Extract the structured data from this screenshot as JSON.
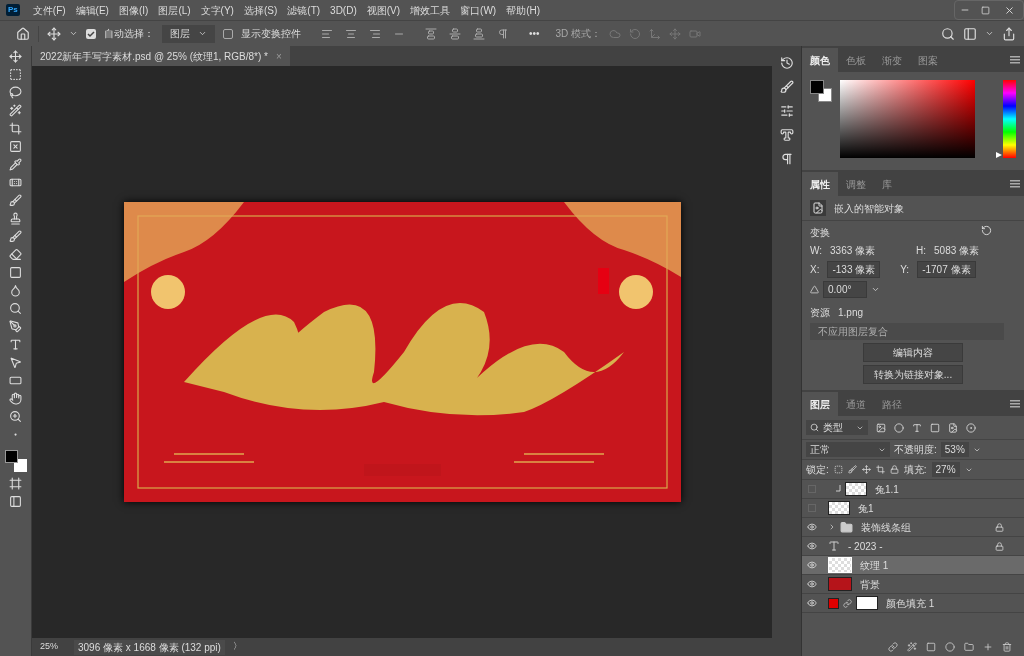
{
  "app_logo": "Ps",
  "menu": [
    "文件(F)",
    "编辑(E)",
    "图像(I)",
    "图层(L)",
    "文字(Y)",
    "选择(S)",
    "滤镜(T)",
    "3D(D)",
    "视图(V)",
    "增效工具",
    "窗口(W)",
    "帮助(H)"
  ],
  "options_bar": {
    "auto_select": {
      "label": "自动选择：",
      "checked": true
    },
    "target": "图层",
    "show_transform": {
      "label": "显示变换控件",
      "checked": false
    },
    "more": "•••",
    "mode_3d": "3D 模式："
  },
  "document_tab": {
    "title": "2022新年手写字素材.psd @ 25% (纹理1, RGB/8*) *",
    "close": "×"
  },
  "color_panel": {
    "tabs": [
      {
        "label": "颜色",
        "selected": true
      },
      {
        "label": "色板",
        "selected": false
      },
      {
        "label": "渐变",
        "selected": false
      },
      {
        "label": "图案",
        "selected": false
      }
    ],
    "hue_slider": {
      "level": 0
    }
  },
  "properties_panel": {
    "tabs": [
      {
        "label": "属性",
        "selected": true
      },
      {
        "label": "调整",
        "selected": false
      },
      {
        "label": "库",
        "selected": false
      }
    ],
    "type": "嵌入的智能对象",
    "section": "变换",
    "w_label": "W:",
    "w": "3363 像素",
    "h_label": "H:",
    "h": "5083 像素",
    "x_label": "X:",
    "x": "-133 像素",
    "y_label": "Y:",
    "y": "-1707 像素",
    "angle": "0.00°",
    "source_label": "资源",
    "source": "1.png",
    "comp": "不应用图层复合",
    "buttons": [
      "编辑内容",
      "转换为链接对象..."
    ]
  },
  "layers_panel": {
    "tabs": [
      {
        "label": "图层",
        "selected": true
      },
      {
        "label": "通道",
        "selected": false
      },
      {
        "label": "路径",
        "selected": false
      }
    ],
    "filter": "类型",
    "blend": "正常",
    "opacity_label": "不透明度:",
    "opacity": "53%",
    "lock_label": "锁定:",
    "fill_label": "填充:",
    "fill": "27%",
    "layers": [
      {
        "name": "兔1.1",
        "visible": false,
        "selected": false,
        "locked": false,
        "clipped": true
      },
      {
        "name": "兔1",
        "visible": false,
        "selected": false,
        "locked": false,
        "clipped": false
      },
      {
        "name": "装饰线条组",
        "kind": "group",
        "visible": true,
        "selected": false,
        "locked": true,
        "clipped": false
      },
      {
        "name": "- 2023 -",
        "kind": "text",
        "visible": true,
        "selected": false,
        "locked": true,
        "clipped": false
      },
      {
        "name": "纹理 1",
        "kind": "smart",
        "visible": true,
        "selected": true,
        "locked": false,
        "clipped": false
      },
      {
        "name": "背景",
        "kind": "fill_red",
        "visible": true,
        "selected": false,
        "locked": false,
        "clipped": false
      },
      {
        "name": "颜色填充 1",
        "kind": "fill",
        "visible": true,
        "selected": false,
        "locked": false,
        "clipped": false
      }
    ]
  },
  "status_bar": {
    "zoom": "25%",
    "size": "3096 像素 x 1668 像素 (132 ppi)",
    "arrow": "〉"
  }
}
